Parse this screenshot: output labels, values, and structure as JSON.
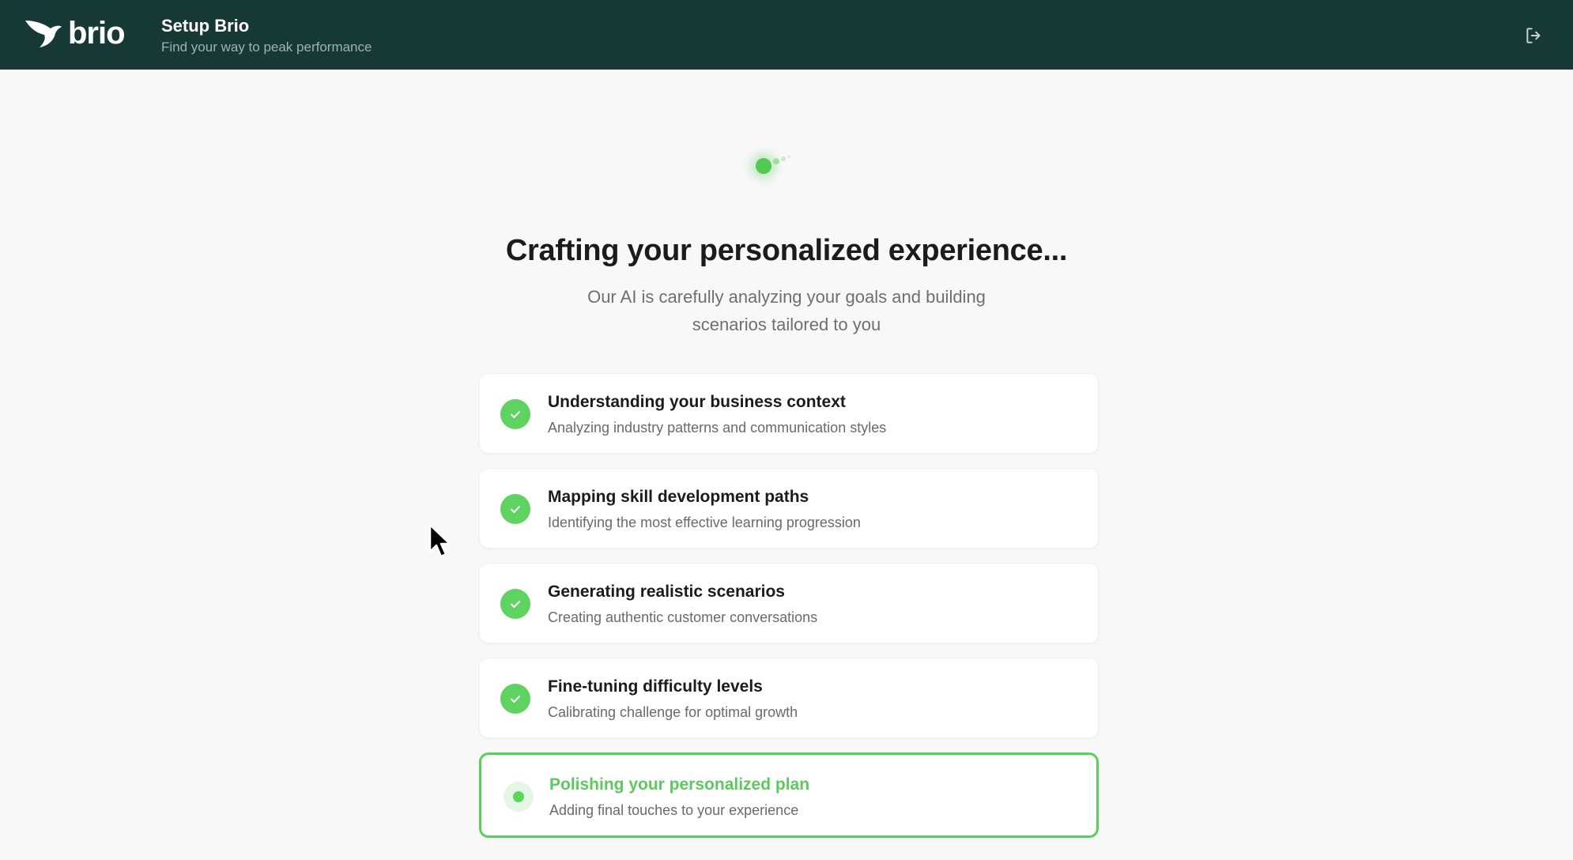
{
  "header": {
    "logo_text": "brio",
    "title": "Setup Brio",
    "subtitle": "Find your way to peak performance",
    "logout_icon": "logout-icon"
  },
  "main": {
    "headline": "Crafting your personalized experience...",
    "subline": "Our AI is carefully analyzing your goals and building scenarios tailored to you",
    "steps": [
      {
        "title": "Understanding your business context",
        "description": "Analyzing industry patterns and communication styles",
        "status": "complete"
      },
      {
        "title": "Mapping skill development paths",
        "description": "Identifying the most effective learning progression",
        "status": "complete"
      },
      {
        "title": "Generating realistic scenarios",
        "description": "Creating authentic customer conversations",
        "status": "complete"
      },
      {
        "title": "Fine-tuning difficulty levels",
        "description": "Calibrating challenge for optimal growth",
        "status": "complete"
      },
      {
        "title": "Polishing your personalized plan",
        "description": "Adding final touches to your experience",
        "status": "in-progress"
      }
    ]
  },
  "colors": {
    "header_bg": "#173935",
    "accent_green": "#5fd35f",
    "page_bg": "#f8f8f8"
  }
}
